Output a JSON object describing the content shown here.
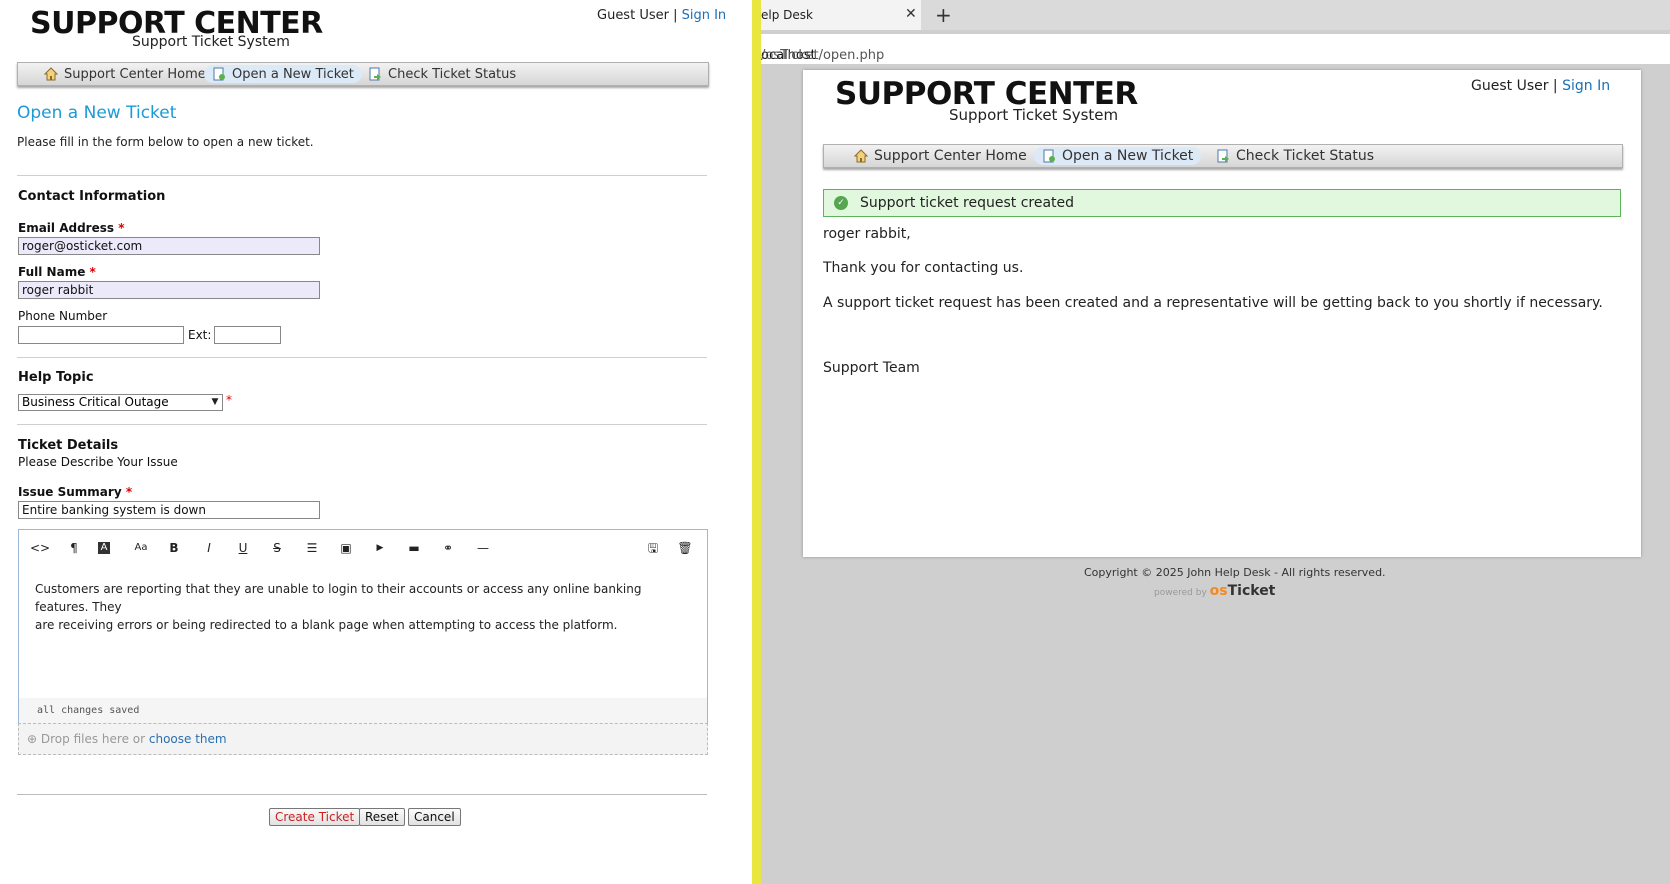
{
  "left": {
    "logo": {
      "title": "SUPPORT CENTER",
      "subtitle": "Support Ticket System"
    },
    "guest": {
      "user": "Guest User |",
      "signin": "Sign In"
    },
    "nav": [
      {
        "label": "Support Center Home",
        "icon": "home-icon"
      },
      {
        "label": "Open a New Ticket",
        "icon": "new-ticket-icon",
        "active": true
      },
      {
        "label": "Check Ticket Status",
        "icon": "ticket-status-icon"
      }
    ],
    "page_title": "Open a New Ticket",
    "intro": "Please fill in the form below to open a new ticket.",
    "contact": {
      "heading": "Contact Information",
      "email_label": "Email Address",
      "email_value": "roger@osticket.com",
      "name_label": "Full Name",
      "name_value": "roger rabbit",
      "phone_label": "Phone Number",
      "ext_label": "Ext:",
      "required": "*"
    },
    "help_topic": {
      "heading": "Help Topic",
      "selected": "Business Critical Outage"
    },
    "details": {
      "heading": "Ticket Details",
      "subheading": "Please Describe Your Issue",
      "summary_label": "Issue Summary",
      "summary_value": "Entire banking system is down",
      "body_line1": "Customers are reporting that they are unable to login to their accounts or access any online banking features. They",
      "body_line2": "are receiving errors or being redirected to a blank page when attempting to access the platform.",
      "status": "all changes saved",
      "drop_text": "Drop files here or",
      "drop_link": "choose them"
    },
    "toolbar": {
      "code": "<>",
      "paragraph": "¶",
      "font_color": "A",
      "font_size": "Aa",
      "bold": "B",
      "italic": "I",
      "underline": "U",
      "strike": "S",
      "list": "☰",
      "image": "▣",
      "video": "▶",
      "table": "▬",
      "link": "⚭",
      "hr": "—",
      "save": "🖫",
      "delete": "🗑"
    },
    "buttons": {
      "create": "Create Ticket",
      "reset": "Reset",
      "cancel": "Cancel"
    }
  },
  "right": {
    "tab_title": "elp Desk",
    "tab_close": "✕",
    "new_tab": "+",
    "url_host": "ocalhost",
    "url_path": "/osTicket/open.php",
    "logo": {
      "title": "SUPPORT CENTER",
      "subtitle": "Support Ticket System"
    },
    "guest": {
      "user": "Guest User |",
      "signin": "Sign In"
    },
    "nav": [
      {
        "label": "Support Center Home"
      },
      {
        "label": "Open a New Ticket",
        "active": true
      },
      {
        "label": "Check Ticket Status"
      }
    ],
    "success": "Support ticket request created",
    "greeting": "roger rabbit,",
    "thanks": "Thank you for contacting us.",
    "message": "A support ticket request has been created and a representative will be getting back to you shortly if necessary.",
    "signature": "Support Team",
    "copyright": "Copyright © 2025 John Help Desk - All rights reserved.",
    "powered_by": "powered by",
    "brand_o": "os",
    "brand_t": "Ticket"
  }
}
